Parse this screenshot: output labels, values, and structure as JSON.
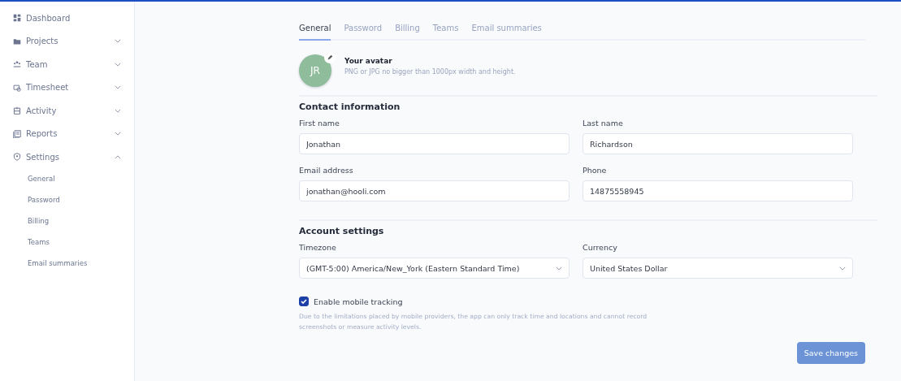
{
  "sidebar": {
    "items": [
      {
        "label": "Dashboard"
      },
      {
        "label": "Projects",
        "expanded": false
      },
      {
        "label": "Team",
        "expanded": false
      },
      {
        "label": "Timesheet",
        "expanded": false
      },
      {
        "label": "Activity",
        "expanded": false
      },
      {
        "label": "Reports",
        "expanded": false
      },
      {
        "label": "Settings",
        "expanded": true,
        "children": [
          {
            "label": "General"
          },
          {
            "label": "Password"
          },
          {
            "label": "Billing"
          },
          {
            "label": "Teams"
          },
          {
            "label": "Email summaries"
          }
        ]
      }
    ]
  },
  "tabs": [
    {
      "label": "General",
      "selected": true
    },
    {
      "label": "Password",
      "selected": false
    },
    {
      "label": "Billing",
      "selected": false
    },
    {
      "label": "Teams",
      "selected": false
    },
    {
      "label": "Email summaries",
      "selected": false
    }
  ],
  "avatar": {
    "initials": "JR",
    "title": "Your avatar",
    "hint": "PNG or JPG no bigger than 1000px width and height."
  },
  "sections": [
    {
      "title": "Contact information",
      "fields": [
        {
          "label": "First name",
          "value": "Jonathan",
          "kind": "text"
        },
        {
          "label": "Last name",
          "value": "Richardson",
          "kind": "text"
        },
        {
          "label": "Email address",
          "value": "jonathan@hooli.com",
          "kind": "text"
        },
        {
          "label": "Phone",
          "value": "14875558945",
          "kind": "text"
        }
      ]
    },
    {
      "title": "Account settings",
      "fields": [
        {
          "label": "Timezone",
          "value": "(GMT-5:00) America/New_York (Eastern Standard Time)",
          "kind": "select"
        },
        {
          "label": "Currency",
          "value": "United States Dollar",
          "kind": "select"
        }
      ]
    }
  ],
  "mobile_tracking": {
    "label": "Enable mobile tracking",
    "checked": true,
    "note": "Due to the limitations placed by mobile providers, the app can only track time and locations and cannot record screenshots or measure activity levels."
  },
  "save_button": "Save changes"
}
